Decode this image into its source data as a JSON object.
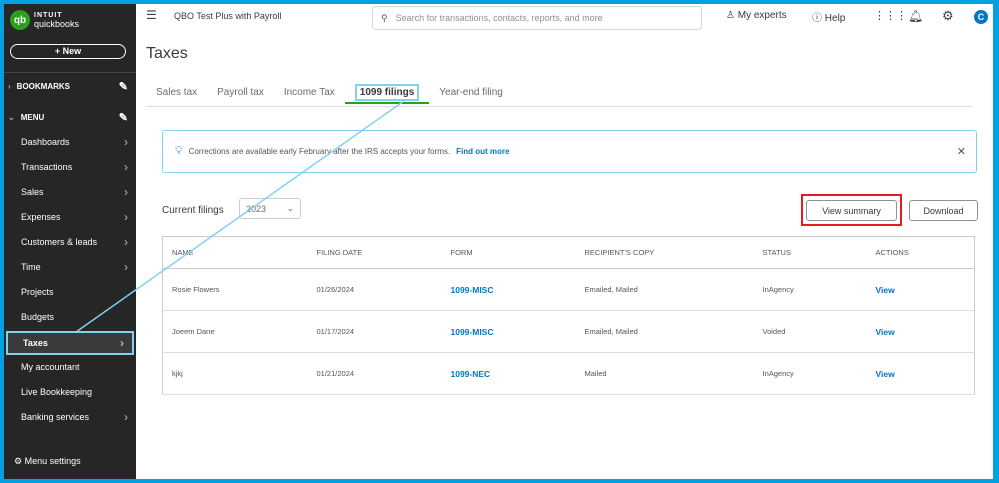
{
  "sidebar": {
    "brand_top": "INTUIT",
    "brand": "quickbooks",
    "new_label": "+ New",
    "bookmarks": "BOOKMARKS",
    "menu": "MENU",
    "items": [
      "Dashboards",
      "Transactions",
      "Sales",
      "Expenses",
      "Customers & leads",
      "Time",
      "Projects",
      "Budgets",
      "Taxes",
      "My accountant",
      "Live Bookkeeping",
      "Banking services"
    ],
    "menu_settings": "Menu settings"
  },
  "topbar": {
    "company": "QBO Test Plus with Payroll",
    "search_placeholder": "Search for transactions, contacts, reports, and more",
    "my_experts": "My experts",
    "help": "Help",
    "avatar": "C"
  },
  "page": {
    "title": "Taxes",
    "tabs": [
      "Sales tax",
      "Payroll tax",
      "Income Tax",
      "1099 filings",
      "Year-end filing"
    ],
    "active_tab": "1099 filings"
  },
  "banner": {
    "text": "Corrections are available early February after the IRS accepts your forms.",
    "link": "Find out more"
  },
  "filings": {
    "label": "Current filings",
    "year": "2023",
    "view_summary": "View summary",
    "download": "Download",
    "columns": [
      "NAME",
      "FILING DATE",
      "FORM",
      "RECIPIENT'S COPY",
      "STATUS",
      "ACTIONS"
    ],
    "rows": [
      {
        "name": "Rosie Flowers",
        "date": "01/26/2024",
        "form": "1099-MISC",
        "copy": "Emailed, Mailed",
        "status": "InAgency",
        "action": "View"
      },
      {
        "name": "Joeem Dane",
        "date": "01/17/2024",
        "form": "1099-MISC",
        "copy": "Emailed, Mailed",
        "status": "Voided",
        "action": "View"
      },
      {
        "name": "kjkj",
        "date": "01/21/2024",
        "form": "1099-NEC",
        "copy": "Mailed",
        "status": "InAgency",
        "action": "View"
      }
    ]
  }
}
